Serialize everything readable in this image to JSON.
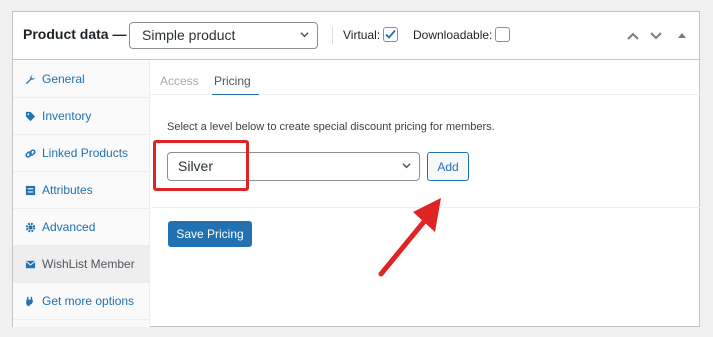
{
  "header": {
    "title": "Product data —",
    "product_type": "Simple product",
    "virtual_label": "Virtual:",
    "virtual_checked": true,
    "downloadable_label": "Downloadable:",
    "downloadable_checked": false
  },
  "sidebar": {
    "items": [
      {
        "label": "General",
        "icon": "wrench-icon"
      },
      {
        "label": "Inventory",
        "icon": "tag-icon"
      },
      {
        "label": "Linked Products",
        "icon": "link-icon"
      },
      {
        "label": "Attributes",
        "icon": "list-icon"
      },
      {
        "label": "Advanced",
        "icon": "gear-icon"
      },
      {
        "label": "WishList Member",
        "icon": "envelope-icon"
      },
      {
        "label": "Get more options",
        "icon": "plugin-icon"
      }
    ],
    "active_index": 5
  },
  "tabs": [
    {
      "label": "Access"
    },
    {
      "label": "Pricing"
    }
  ],
  "active_tab": 1,
  "pricing": {
    "instruction": "Select a level below to create special discount pricing for members.",
    "level_value": "Silver",
    "add_label": "Add",
    "save_label": "Save Pricing"
  },
  "colors": {
    "accent": "#2271b1",
    "annotation": "#e02424"
  }
}
